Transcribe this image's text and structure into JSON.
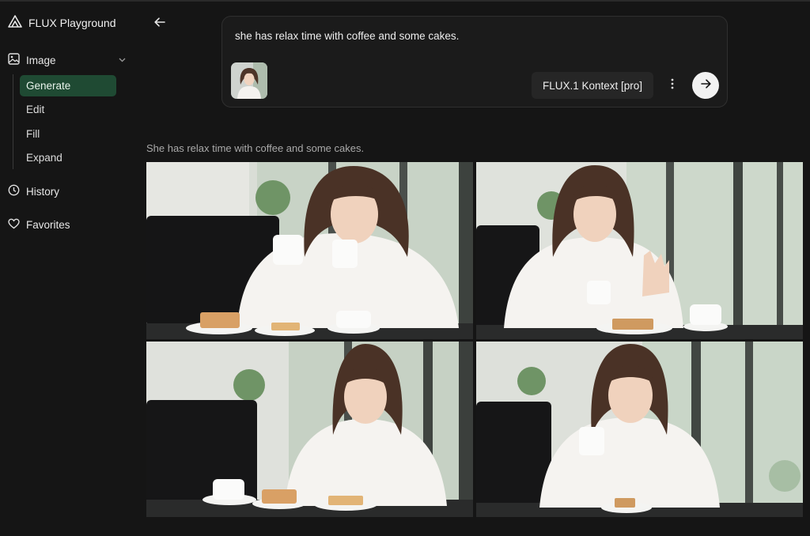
{
  "app": {
    "title": "FLUX Playground"
  },
  "sidebar": {
    "sections": [
      {
        "label": "Image",
        "icon": "image-icon"
      },
      {
        "label": "History",
        "icon": "clock-icon"
      },
      {
        "label": "Favorites",
        "icon": "heart-icon"
      }
    ],
    "image_items": [
      "Generate",
      "Edit",
      "Fill",
      "Expand"
    ],
    "active_item": "Generate"
  },
  "prompt": {
    "text": "she has relax time with coffee and some cakes.",
    "model": "FLUX.1 Kontext [pro]"
  },
  "result": {
    "caption": "She has relax time with coffee and some cakes.",
    "images": [
      {
        "id": "result-image-1"
      },
      {
        "id": "result-image-2"
      },
      {
        "id": "result-image-3"
      },
      {
        "id": "result-image-4"
      }
    ]
  },
  "colors": {
    "background": "#151515",
    "active_nav": "#1f4a33",
    "card": "#1b1b1b",
    "model_button": "#262626",
    "send_button": "#f2f2f2"
  }
}
